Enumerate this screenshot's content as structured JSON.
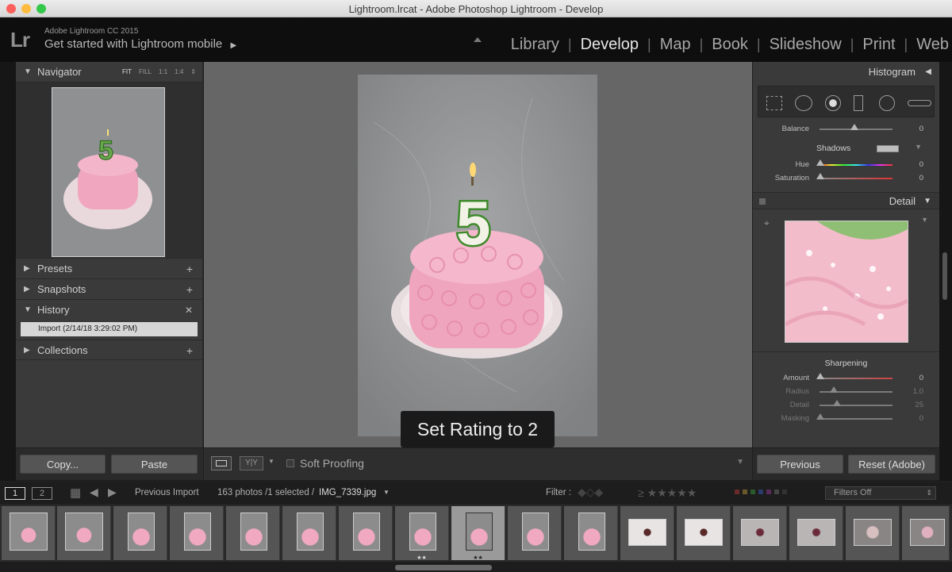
{
  "window": {
    "title": "Lightroom.lrcat - Adobe Photoshop Lightroom - Develop"
  },
  "identity": {
    "logo": "Lr",
    "version": "Adobe Lightroom CC 2015",
    "mobile": "Get started with Lightroom mobile"
  },
  "modules": [
    "Library",
    "Develop",
    "Map",
    "Book",
    "Slideshow",
    "Print",
    "Web"
  ],
  "active_module": "Develop",
  "left": {
    "navigator": "Navigator",
    "nav_options": [
      "FIT",
      "FILL",
      "1:1",
      "1:4"
    ],
    "presets": "Presets",
    "snapshots": "Snapshots",
    "history": "History",
    "history_item": "Import (2/14/18 3:29:02 PM)",
    "collections": "Collections",
    "copy": "Copy...",
    "paste": "Paste"
  },
  "center": {
    "overlay": "Set Rating to 2",
    "candle_number": "5",
    "soft_proofing": "Soft Proofing"
  },
  "right": {
    "histogram": "Histogram",
    "balance": {
      "label": "Balance",
      "value": "0"
    },
    "shadows": "Shadows",
    "hue": {
      "label": "Hue",
      "value": "0"
    },
    "saturation": {
      "label": "Saturation",
      "value": "0"
    },
    "detail": "Detail",
    "sharpening": "Sharpening",
    "amount": {
      "label": "Amount",
      "value": "0"
    },
    "radius": {
      "label": "Radius",
      "value": "1.0"
    },
    "detail_slider": {
      "label": "Detail",
      "value": "25"
    },
    "masking": {
      "label": "Masking",
      "value": "0"
    },
    "previous": "Previous",
    "reset": "Reset (Adobe)"
  },
  "filmstrip": {
    "screen1": "1",
    "screen2": "2",
    "source": "Previous Import",
    "count": "163 photos /1 selected /",
    "filename": "IMG_7339.jpg",
    "filter_label": "Filter :",
    "filters_off": "Filters Off",
    "rating_stars": "★★"
  }
}
